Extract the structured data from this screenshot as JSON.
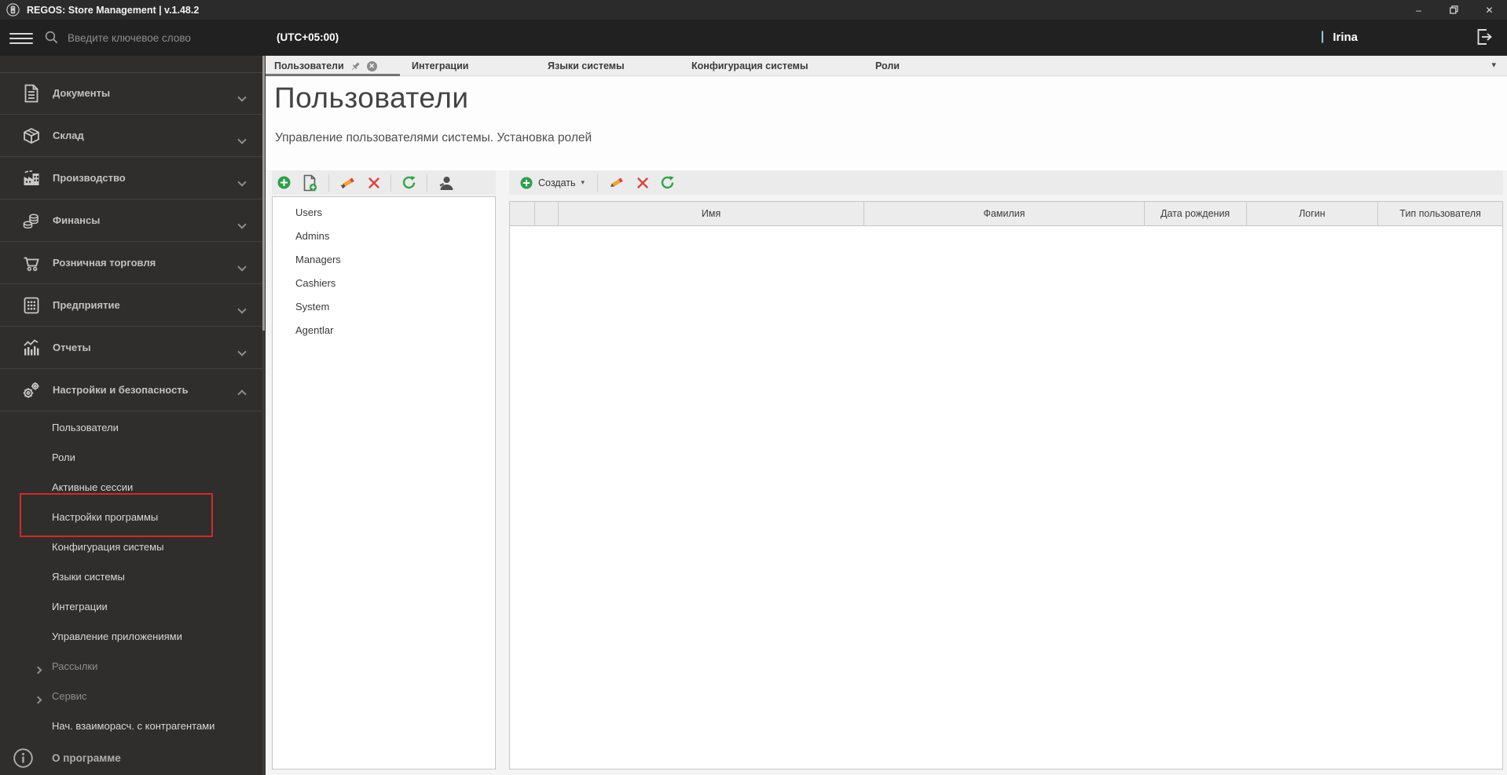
{
  "window": {
    "title": "REGOS: Store Management | v.1.48.2",
    "minimize_glyph": "–",
    "close_glyph": "✕"
  },
  "topbar": {
    "search_placeholder": "Введите ключевое слово",
    "timezone": "(UTC+05:00)",
    "user_divider": "|",
    "username": "Irina"
  },
  "sidebar": {
    "items": [
      {
        "label": "Документы",
        "icon": "document-icon"
      },
      {
        "label": "Склад",
        "icon": "box-icon"
      },
      {
        "label": "Производство",
        "icon": "factory-icon"
      },
      {
        "label": "Финансы",
        "icon": "coins-icon"
      },
      {
        "label": "Розничная торговля",
        "icon": "cart-icon"
      },
      {
        "label": "Предприятие",
        "icon": "building-icon"
      },
      {
        "label": "Отчеты",
        "icon": "chart-icon"
      },
      {
        "label": "Настройки и безопасность",
        "icon": "gears-icon",
        "expanded": true
      }
    ],
    "submenu": [
      {
        "label": "Пользователи"
      },
      {
        "label": "Роли"
      },
      {
        "label": "Активные сессии"
      },
      {
        "label": "Настройки программы",
        "highlighted": true
      },
      {
        "label": "Конфигурация системы"
      },
      {
        "label": "Языки системы"
      },
      {
        "label": "Интеграции"
      },
      {
        "label": "Управление приложениями"
      },
      {
        "label": "Рассылки",
        "has_children": true
      },
      {
        "label": "Сервис",
        "has_children": true
      },
      {
        "label": "Нач. взаиморасч. с контрагентами"
      }
    ],
    "about_label": "О программе",
    "highlight_color": "#cf2b2b"
  },
  "tabs": [
    {
      "label": "Пользователи",
      "active": true
    },
    {
      "label": "Интеграции"
    },
    {
      "label": "Языки системы"
    },
    {
      "label": "Конфигурация системы"
    },
    {
      "label": "Роли"
    }
  ],
  "page": {
    "title": "Пользователи",
    "subtitle": "Управление пользователями системы. Установка ролей"
  },
  "groups_panel": {
    "items": [
      "Users",
      "Admins",
      "Managers",
      "Cashiers",
      "System",
      "Agentlar"
    ]
  },
  "users_toolbar": {
    "create_label": "Создать",
    "create_caret": "▾"
  },
  "tabbar_overflow_caret": "▾",
  "users_table": {
    "columns": [
      "Имя",
      "Фамилия",
      "Дата рождения",
      "Логин",
      "Тип пользователя"
    ],
    "rows": []
  },
  "colors": {
    "accent_green": "#2f9e4c",
    "danger_red": "#d9453e",
    "pencil_orange": "#f2a33c",
    "titlebar_bg": "#2b2b2b",
    "topbar_bg": "#212121",
    "sidebar_bg": "#2f2e2c"
  }
}
